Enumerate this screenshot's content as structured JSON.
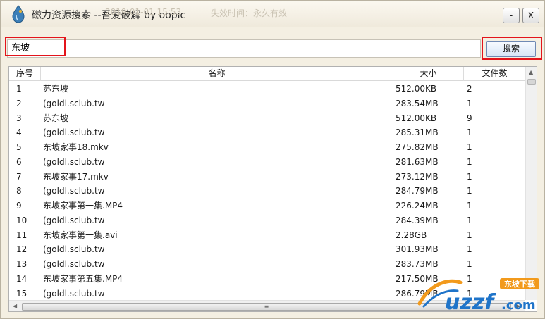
{
  "window": {
    "title": "磁力资源搜索 --吾爱破解 by oopic",
    "ghost_left": "2019-01-01 15:53",
    "ghost_right": "失效时间：永久有效",
    "minimize_label": "-",
    "close_label": "X"
  },
  "search": {
    "value": "东坡",
    "button_label": "搜索"
  },
  "table": {
    "columns": [
      "序号",
      "名称",
      "大小",
      "文件数"
    ],
    "rows": [
      {
        "no": "1",
        "name": "苏东坡",
        "size": "512.00KB",
        "files": "2"
      },
      {
        "no": "2",
        "name": "(goldl.sclub.tw",
        "size": "283.54MB",
        "files": "1"
      },
      {
        "no": "3",
        "name": "苏东坡",
        "size": "512.00KB",
        "files": "9"
      },
      {
        "no": "4",
        "name": "(goldl.sclub.tw",
        "size": "285.31MB",
        "files": "1"
      },
      {
        "no": "5",
        "name": "东坡家事18.mkv",
        "size": "275.82MB",
        "files": "1"
      },
      {
        "no": "6",
        "name": "(goldl.sclub.tw",
        "size": "281.63MB",
        "files": "1"
      },
      {
        "no": "7",
        "name": "东坡家事17.mkv",
        "size": "273.12MB",
        "files": "1"
      },
      {
        "no": "8",
        "name": "(goldl.sclub.tw",
        "size": "284.79MB",
        "files": "1"
      },
      {
        "no": "9",
        "name": "东坡家事第一集.MP4",
        "size": "226.24MB",
        "files": "1"
      },
      {
        "no": "10",
        "name": "(goldl.sclub.tw",
        "size": "284.39MB",
        "files": "1"
      },
      {
        "no": "11",
        "name": "东坡家事第一集.avi",
        "size": "2.28GB",
        "files": "1"
      },
      {
        "no": "12",
        "name": "(goldl.sclub.tw",
        "size": "301.93MB",
        "files": "1"
      },
      {
        "no": "13",
        "name": "(goldl.sclub.tw",
        "size": "283.73MB",
        "files": "1"
      },
      {
        "no": "14",
        "name": "东坡家事第五集.MP4",
        "size": "217.50MB",
        "files": "1"
      },
      {
        "no": "15",
        "name": "(goldl.sclub.tw",
        "size": "286.79MB",
        "files": "1"
      }
    ]
  },
  "watermark": {
    "brand": "uzzf",
    "suffix": ".com",
    "tag": "东坡下载"
  },
  "colors": {
    "highlight": "#e3141b",
    "window_bg": "#f4efe2",
    "watermark_blue": "#1f74c9",
    "watermark_orange": "#f29a1c"
  }
}
